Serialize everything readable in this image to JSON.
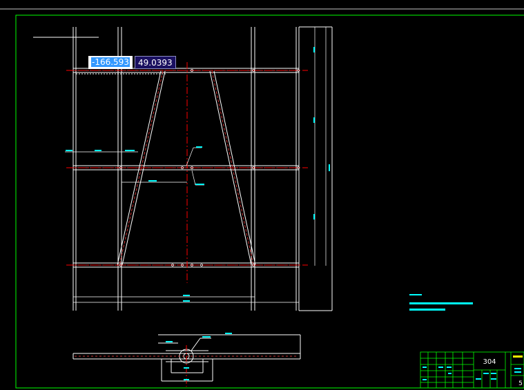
{
  "colors": {
    "background": "#000000",
    "frame": "#00ff00",
    "geometry": "#ffffff",
    "centerline": "#ff0000",
    "member_hatch": "#cc3333",
    "dimension": "#00ffff",
    "notes": "#00ffff",
    "titleblock_accent": "#ffff00"
  },
  "dynamic_input": {
    "x_value": "-166.593",
    "y_value": "49.0393"
  },
  "titleblock": {
    "drawing_number": "304",
    "sheet_number": "5"
  }
}
